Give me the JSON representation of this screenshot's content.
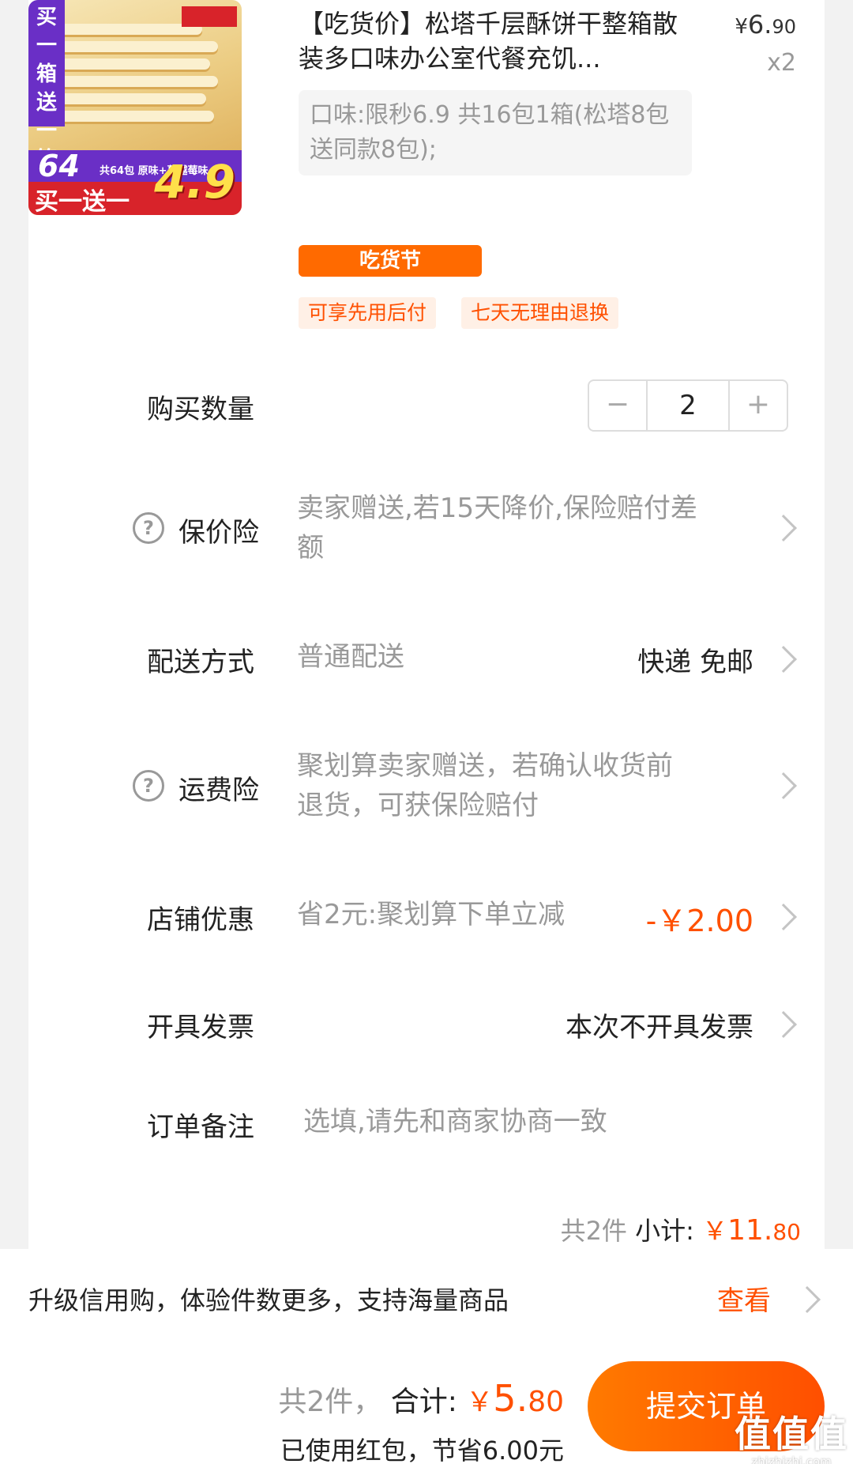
{
  "product": {
    "thumb": {
      "banner_vertical": "买一箱送一箱",
      "count_num": "64",
      "count_text": "共64包 原味+蔓越莓味",
      "buy_one": "买一送一",
      "price": "4.9"
    },
    "title": "【吃货价】松塔千层酥饼干整箱散装多口味办公室代餐充饥...",
    "price_symbol": "¥",
    "price_int": "6.",
    "price_dec": "90",
    "quantity_badge": "x2",
    "sku": "口味:限秒6.9 共16包1箱(松塔8包送同款8包);",
    "promo_tag": "吃货节",
    "service_tags": [
      "可享先用后付",
      "七天无理由退换"
    ]
  },
  "quantity": {
    "label": "购买数量",
    "minus": "−",
    "value": "2",
    "plus": "+"
  },
  "price_protection": {
    "icon": "help-circle-icon",
    "label": "保价险",
    "desc_line1": "卖家赠送,若15天降价,保险赔付差",
    "desc_line2": "额"
  },
  "delivery": {
    "label": "配送方式",
    "desc": "普通配送",
    "value": "快递 免邮"
  },
  "shipping_insurance": {
    "icon": "help-circle-icon",
    "label": "运费险",
    "desc_line1": "聚划算卖家赠送，若确认收货前",
    "desc_line2": "退货，可获保险赔付"
  },
  "shop_discount": {
    "label": "店铺优惠",
    "desc": "省2元:聚划算下单立减",
    "value": "-￥2.00"
  },
  "invoice": {
    "label": "开具发票",
    "value": "本次不开具发票"
  },
  "remark": {
    "label": "订单备注",
    "placeholder": "选填,请先和商家协商一致"
  },
  "subtotal": {
    "count": "共2件",
    "label": "小计:",
    "symbol": "￥",
    "int": "11.",
    "dec": "80"
  },
  "credit": {
    "text": "升级信用购，体验件数更多，支持海量商品",
    "link": "查看"
  },
  "footer": {
    "count": "共2件，",
    "label": "合计:",
    "symbol": "￥",
    "int": "5.",
    "dec": "80",
    "saved": "已使用红包，节省6.00元",
    "submit": "提交订单",
    "watermark_mark": "值值值",
    "watermark_text": "zhizhizhi.com"
  },
  "colors": {
    "accent": "#ff5000",
    "promo": "#ff6a00",
    "muted": "#999999"
  }
}
